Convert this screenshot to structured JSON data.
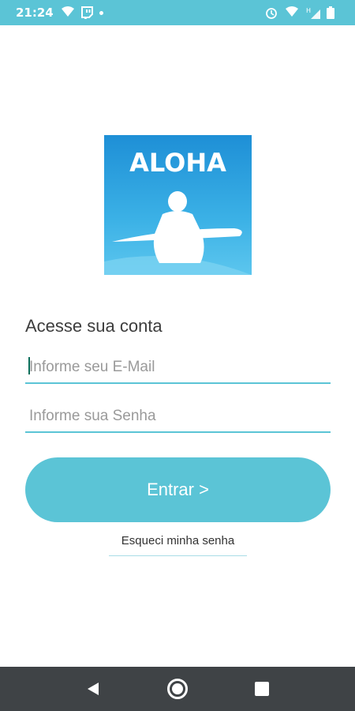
{
  "status_bar": {
    "time": "21:24",
    "left_icons": [
      "wifi-icon",
      "twitch-icon",
      "dot-icon"
    ],
    "right_icons": [
      "alarm-icon",
      "wifi-icon",
      "signal-h-icon",
      "battery-icon"
    ]
  },
  "logo": {
    "text": "ALOHA",
    "icon": "surfer-silhouette-icon"
  },
  "login": {
    "title": "Acesse sua conta",
    "email_placeholder": "Informe seu E-Mail",
    "email_value": "",
    "password_placeholder": "Informe sua Senha",
    "password_value": "",
    "submit_label": "Entrar >",
    "forgot_label": "Esqueci minha senha"
  },
  "nav_bar": {
    "buttons": [
      "back-icon",
      "home-icon",
      "recents-icon"
    ]
  },
  "colors": {
    "accent": "#5bc4d6",
    "nav": "#3f4346",
    "logo_blue": "#2aa0dc"
  }
}
